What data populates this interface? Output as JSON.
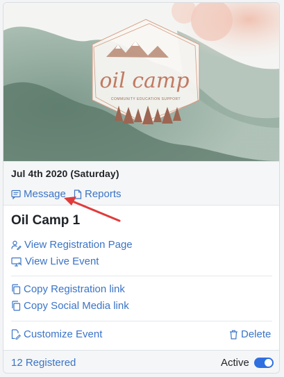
{
  "event": {
    "date": "Jul 4th 2020 (Saturday)",
    "title": "Oil Camp 1",
    "logo_text": "oil camp",
    "logo_tagline": "COMMUNITY EDUCATION SUPPORT"
  },
  "quick_links": {
    "message": "Message",
    "reports": "Reports"
  },
  "actions": {
    "view_registration": "View Registration Page",
    "view_live": "View Live Event",
    "copy_registration": "Copy Registration link",
    "copy_social": "Copy Social Media link",
    "customize": "Customize Event",
    "delete": "Delete"
  },
  "footer": {
    "registered": "12 Registered",
    "active_label": "Active",
    "active_on": true
  },
  "colors": {
    "link": "#3a74c6",
    "toggle_on": "#2f6fe0",
    "annotation_arrow": "#e03b3b"
  }
}
